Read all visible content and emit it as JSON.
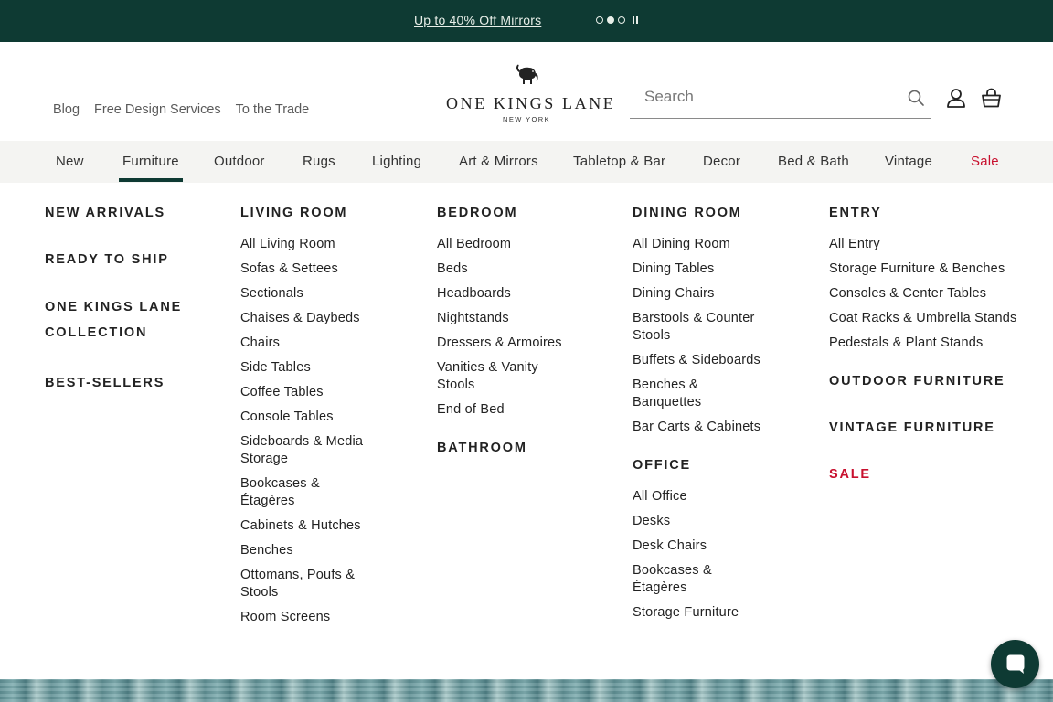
{
  "promo": {
    "text": "Up to 40% Off Mirrors",
    "slide_count": 3,
    "active_slide": 2
  },
  "header": {
    "util_links": [
      "Blog",
      "Free Design Services",
      "To the Trade"
    ],
    "logo": {
      "main": "ONE KINGS LANE",
      "sub": "NEW YORK"
    },
    "search": {
      "placeholder": "Search"
    },
    "icons": [
      "search-icon",
      "account-icon",
      "cart-icon"
    ]
  },
  "nav": {
    "items": [
      "New",
      "Furniture",
      "Outdoor",
      "Rugs",
      "Lighting",
      "Art & Mirrors",
      "Tabletop & Bar",
      "Decor",
      "Bed & Bath",
      "Vintage",
      "Sale"
    ],
    "active": "Furniture"
  },
  "mega": {
    "col1": {
      "headings": [
        "NEW ARRIVALS",
        "READY TO SHIP",
        "ONE KINGS LANE COLLECTION",
        "BEST-SELLERS"
      ]
    },
    "col2": {
      "heading": "LIVING ROOM",
      "links": [
        "All Living Room",
        "Sofas & Settees",
        "Sectionals",
        "Chaises & Daybeds",
        "Chairs",
        "Side Tables",
        "Coffee Tables",
        "Console Tables",
        "Sideboards & Media Storage",
        "Bookcases & Étagères",
        "Cabinets & Hutches",
        "Benches",
        "Ottomans, Poufs & Stools",
        "Room Screens"
      ]
    },
    "col3": {
      "heading": "BEDROOM",
      "links": [
        "All Bedroom",
        "Beds",
        "Headboards",
        "Nightstands",
        "Dressers & Armoires",
        "Vanities & Vanity Stools",
        "End of Bed"
      ],
      "heading2": "BATHROOM"
    },
    "col4": {
      "heading": "DINING ROOM",
      "links": [
        "All Dining Room",
        "Dining Tables",
        "Dining Chairs",
        "Barstools & Counter Stools",
        "Buffets & Sideboards",
        "Benches & Banquettes",
        "Bar Carts & Cabinets"
      ],
      "heading2": "OFFICE",
      "links2": [
        "All Office",
        "Desks",
        "Desk Chairs",
        "Bookcases & Étagères",
        "Storage Furniture"
      ]
    },
    "col5": {
      "heading": "ENTRY",
      "links": [
        "All Entry",
        "Storage Furniture & Benches",
        "Consoles & Center Tables",
        "Coat Racks & Umbrella Stands",
        "Pedestals & Plant Stands"
      ],
      "headings_extra": [
        "OUTDOOR FURNITURE",
        "VINTAGE FURNITURE",
        "SALE"
      ]
    }
  },
  "colors": {
    "brand_green": "#0e3a33",
    "sale_red": "#c8102e",
    "nav_bg": "#f4f4f2"
  },
  "chat": {
    "icon": "chat-icon"
  }
}
